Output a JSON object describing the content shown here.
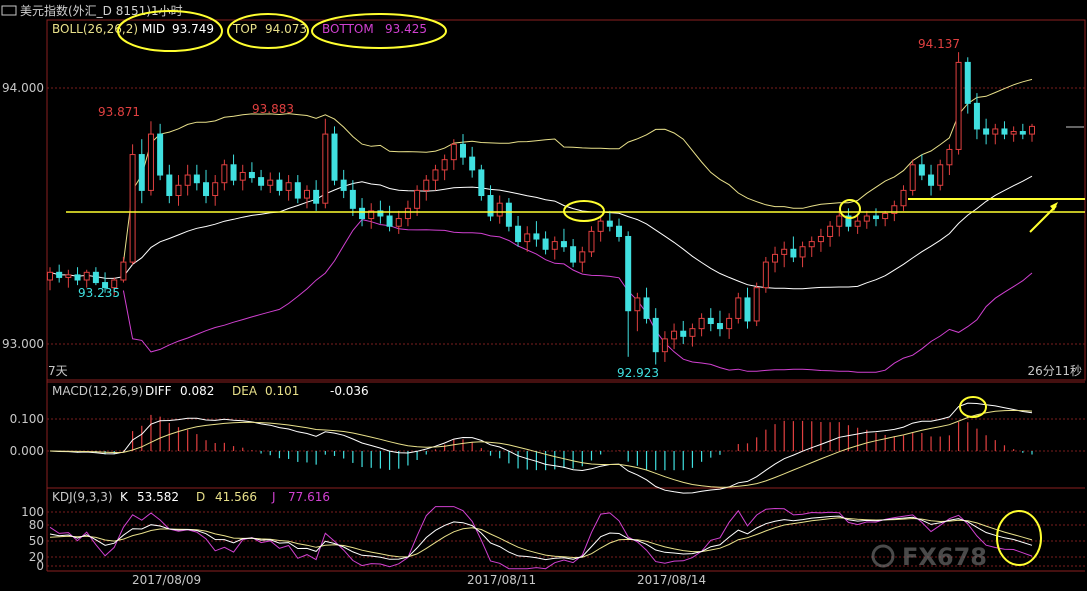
{
  "window": {
    "title": "美元指数(外汇_D 8151)1小时",
    "icon": "window-menu-icon"
  },
  "colors": {
    "background": "#000000",
    "up": "#e04040",
    "down": "#40e0e0",
    "mid": "#ffffff",
    "top": "#e8e08a",
    "bottom": "#d040d0",
    "grid": "#7a1e1e",
    "annotation": "#ffff30",
    "kdj_k": "#ffffff",
    "kdj_d": "#e8e08a",
    "kdj_j": "#d040d0"
  },
  "boll": {
    "label": "BOLL(26,26,2)",
    "mid_label": "MID",
    "mid_value": "93.749",
    "top_label": "TOP",
    "top_value": "94.073",
    "bottom_label": "BOTTOM",
    "bottom_value": "93.425"
  },
  "macd": {
    "label": "MACD(12,26,9)",
    "diff_label": "DIFF",
    "diff_value": "0.082",
    "dea_label": "DEA",
    "dea_value": "0.101",
    "macd_value": "-0.036",
    "ticks": [
      "0.100",
      "0.000"
    ]
  },
  "kdj": {
    "label": "KDJ(9,3,3)",
    "k_label": "K",
    "k_value": "53.582",
    "d_label": "D",
    "d_value": "41.566",
    "j_label": "J",
    "j_value": "77.616",
    "ticks": [
      "100",
      "80",
      "50",
      "20",
      "0"
    ]
  },
  "price_labels": {
    "high1": "93.871",
    "high2": "93.883",
    "high3": "94.137",
    "low1": "93.235",
    "low2": "92.923"
  },
  "left_bottom_label": "7天",
  "countdown": "26分11秒",
  "watermark": "FX678",
  "chart_data": {
    "type": "candlestick",
    "title": "美元指数(外汇_D 8151)1小时",
    "ylim": [
      92.9,
      94.2
    ],
    "yticks": [
      "94.000",
      "93.000"
    ],
    "x_labels": [
      "2017/08/09",
      "2017/08/11",
      "2017/08/14"
    ],
    "candles": [
      [
        93.25,
        93.3,
        93.21,
        93.28
      ],
      [
        93.28,
        93.31,
        93.24,
        93.26
      ],
      [
        93.26,
        93.29,
        93.22,
        93.27
      ],
      [
        93.27,
        93.3,
        93.23,
        93.25
      ],
      [
        93.25,
        93.29,
        93.22,
        93.28
      ],
      [
        93.28,
        93.3,
        93.23,
        93.24
      ],
      [
        93.24,
        93.28,
        93.2,
        93.22
      ],
      [
        93.22,
        93.26,
        93.19,
        93.25
      ],
      [
        93.25,
        93.34,
        93.24,
        93.32
      ],
      [
        93.32,
        93.78,
        93.31,
        93.74
      ],
      [
        93.74,
        93.8,
        93.55,
        93.6
      ],
      [
        93.6,
        93.87,
        93.58,
        93.82
      ],
      [
        93.82,
        93.86,
        93.64,
        93.66
      ],
      [
        93.66,
        93.7,
        93.55,
        93.58
      ],
      [
        93.58,
        93.66,
        93.54,
        93.62
      ],
      [
        93.62,
        93.7,
        93.58,
        93.66
      ],
      [
        93.66,
        93.7,
        93.6,
        93.63
      ],
      [
        93.63,
        93.68,
        93.55,
        93.58
      ],
      [
        93.58,
        93.66,
        93.54,
        93.63
      ],
      [
        93.63,
        93.72,
        93.6,
        93.7
      ],
      [
        93.7,
        93.74,
        93.62,
        93.64
      ],
      [
        93.64,
        93.7,
        93.6,
        93.67
      ],
      [
        93.67,
        93.71,
        93.63,
        93.65
      ],
      [
        93.65,
        93.68,
        93.6,
        93.62
      ],
      [
        93.62,
        93.67,
        93.59,
        93.64
      ],
      [
        93.64,
        93.67,
        93.58,
        93.6
      ],
      [
        93.6,
        93.66,
        93.56,
        93.63
      ],
      [
        93.63,
        93.66,
        93.55,
        93.57
      ],
      [
        93.57,
        93.62,
        93.53,
        93.6
      ],
      [
        93.6,
        93.64,
        93.52,
        93.55
      ],
      [
        93.55,
        93.88,
        93.53,
        93.82
      ],
      [
        93.82,
        93.85,
        93.62,
        93.64
      ],
      [
        93.64,
        93.68,
        93.57,
        93.6
      ],
      [
        93.6,
        93.64,
        93.5,
        93.53
      ],
      [
        93.53,
        93.57,
        93.46,
        93.49
      ],
      [
        93.49,
        93.55,
        93.45,
        93.52
      ],
      [
        93.52,
        93.56,
        93.47,
        93.5
      ],
      [
        93.5,
        93.54,
        93.44,
        93.46
      ],
      [
        93.46,
        93.52,
        93.43,
        93.49
      ],
      [
        93.49,
        93.56,
        93.46,
        93.53
      ],
      [
        93.53,
        93.62,
        93.5,
        93.6
      ],
      [
        93.6,
        93.66,
        93.56,
        93.64
      ],
      [
        93.64,
        93.7,
        93.6,
        93.68
      ],
      [
        93.68,
        93.74,
        93.64,
        93.72
      ],
      [
        93.72,
        93.8,
        93.68,
        93.78
      ],
      [
        93.78,
        93.82,
        93.7,
        93.73
      ],
      [
        93.73,
        93.77,
        93.65,
        93.68
      ],
      [
        93.68,
        93.7,
        93.56,
        93.58
      ],
      [
        93.58,
        93.62,
        93.48,
        93.5
      ],
      [
        93.5,
        93.58,
        93.47,
        93.55
      ],
      [
        93.55,
        93.57,
        93.44,
        93.46
      ],
      [
        93.46,
        93.5,
        93.38,
        93.4
      ],
      [
        93.4,
        93.46,
        93.36,
        93.43
      ],
      [
        93.43,
        93.48,
        93.38,
        93.41
      ],
      [
        93.41,
        93.44,
        93.35,
        93.37
      ],
      [
        93.37,
        93.42,
        93.33,
        93.4
      ],
      [
        93.4,
        93.45,
        93.36,
        93.38
      ],
      [
        93.38,
        93.41,
        93.3,
        93.32
      ],
      [
        93.32,
        93.38,
        93.28,
        93.36
      ],
      [
        93.36,
        93.46,
        93.34,
        93.44
      ],
      [
        93.44,
        93.5,
        93.4,
        93.48
      ],
      [
        93.48,
        93.52,
        93.44,
        93.46
      ],
      [
        93.46,
        93.49,
        93.4,
        93.42
      ],
      [
        93.42,
        93.44,
        92.95,
        93.13
      ],
      [
        93.13,
        93.2,
        93.05,
        93.18
      ],
      [
        93.18,
        93.22,
        93.08,
        93.1
      ],
      [
        93.1,
        93.14,
        92.92,
        92.97
      ],
      [
        92.97,
        93.05,
        92.93,
        93.02
      ],
      [
        93.02,
        93.08,
        92.98,
        93.05
      ],
      [
        93.05,
        93.09,
        93.0,
        93.03
      ],
      [
        93.03,
        93.08,
        92.99,
        93.06
      ],
      [
        93.06,
        93.12,
        93.03,
        93.1
      ],
      [
        93.1,
        93.14,
        93.05,
        93.08
      ],
      [
        93.08,
        93.13,
        93.03,
        93.06
      ],
      [
        93.06,
        93.12,
        93.02,
        93.1
      ],
      [
        93.1,
        93.2,
        93.08,
        93.18
      ],
      [
        93.18,
        93.22,
        93.06,
        93.09
      ],
      [
        93.09,
        93.24,
        93.07,
        93.22
      ],
      [
        93.22,
        93.34,
        93.2,
        93.32
      ],
      [
        93.32,
        93.38,
        93.28,
        93.35
      ],
      [
        93.35,
        93.4,
        93.3,
        93.37
      ],
      [
        93.37,
        93.42,
        93.32,
        93.34
      ],
      [
        93.34,
        93.4,
        93.3,
        93.38
      ],
      [
        93.38,
        93.42,
        93.34,
        93.4
      ],
      [
        93.4,
        93.45,
        93.36,
        93.42
      ],
      [
        93.42,
        93.48,
        93.38,
        93.46
      ],
      [
        93.46,
        93.52,
        93.42,
        93.5
      ],
      [
        93.5,
        93.53,
        93.44,
        93.46
      ],
      [
        93.46,
        93.5,
        93.43,
        93.48
      ],
      [
        93.48,
        93.52,
        93.45,
        93.5
      ],
      [
        93.5,
        93.53,
        93.46,
        93.49
      ],
      [
        93.49,
        93.52,
        93.46,
        93.51
      ],
      [
        93.51,
        93.56,
        93.48,
        93.54
      ],
      [
        93.54,
        93.62,
        93.52,
        93.6
      ],
      [
        93.6,
        93.72,
        93.58,
        93.7
      ],
      [
        93.7,
        93.74,
        93.64,
        93.66
      ],
      [
        93.66,
        93.7,
        93.58,
        93.62
      ],
      [
        93.62,
        93.72,
        93.6,
        93.7
      ],
      [
        93.7,
        93.78,
        93.66,
        93.76
      ],
      [
        93.76,
        94.14,
        93.74,
        94.1
      ],
      [
        94.1,
        94.12,
        93.9,
        93.94
      ],
      [
        93.94,
        93.98,
        93.8,
        93.84
      ],
      [
        93.84,
        93.88,
        93.78,
        93.82
      ],
      [
        93.82,
        93.86,
        93.78,
        93.84
      ],
      [
        93.84,
        93.87,
        93.8,
        93.82
      ],
      [
        93.82,
        93.85,
        93.79,
        93.83
      ],
      [
        93.83,
        93.86,
        93.8,
        93.82
      ],
      [
        93.82,
        93.86,
        93.79,
        93.85
      ]
    ],
    "macd_note": "MACD histogram with DIFF and DEA lines",
    "kdj_note": "KDJ oscillator with K, D, J lines"
  }
}
